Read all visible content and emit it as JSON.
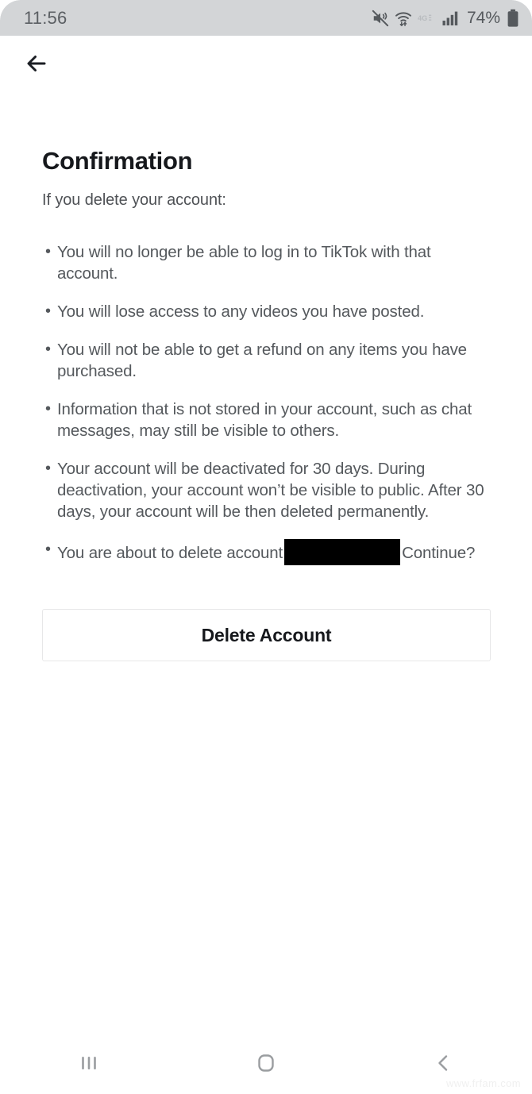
{
  "status_bar": {
    "time": "11:56",
    "battery_percent": "74%",
    "icons": [
      "mute-vibrate-icon",
      "wifi-icon",
      "4g-icon",
      "signal-bars-icon",
      "battery-icon"
    ],
    "network_label": "4G",
    "background_color": "#d3d5d7"
  },
  "nav": {
    "back_arrow_icon": "back-arrow-icon"
  },
  "page": {
    "title": "Confirmation",
    "subtitle": "If you delete your account:",
    "bullets": [
      {
        "text": "You will no longer be able to log in to TikTok with that account."
      },
      {
        "text": "You will lose access to any videos you have posted."
      },
      {
        "text": "You will not be able to get a refund on any items you have purchased."
      },
      {
        "text": "Information that is not stored in your account, such as chat messages, may still be visible to others."
      },
      {
        "text": "Your account will be deactivated for 30 days. During deactivation, your account won’t be visible to public. After 30 days, your account will be then deleted permanently."
      }
    ],
    "final_bullet": {
      "before_redaction": "You are about to delete account",
      "redacted_value": "",
      "after_redaction": "Continue?"
    }
  },
  "actions": {
    "delete_account_label": "Delete Account"
  },
  "system_nav": {
    "recents_icon": "recents-icon",
    "home_icon": "home-icon",
    "back_icon": "back-chevron-icon"
  },
  "watermark": {
    "text": "www.frfam.com"
  },
  "colors": {
    "text_primary": "#16181c",
    "text_secondary": "#55595d",
    "status_bar_bg": "#d3d5d7",
    "button_border": "#e7e7e8",
    "redaction": "#000000"
  }
}
